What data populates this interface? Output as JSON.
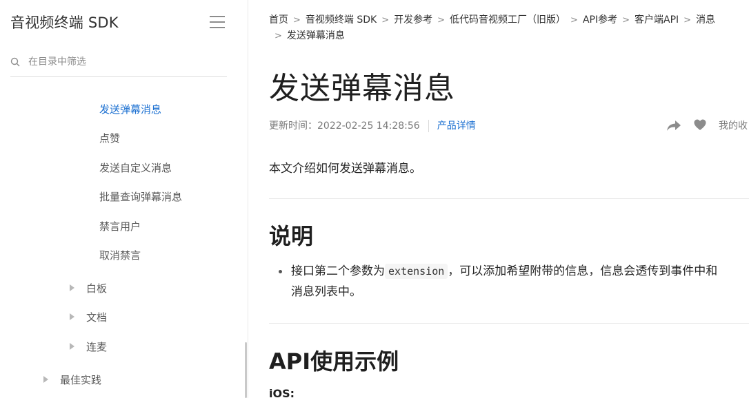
{
  "sidebar": {
    "title": "音视频终端 SDK",
    "filter_placeholder": "在目录中筛选",
    "items": [
      {
        "label": "发送弹幕消息",
        "active": true
      },
      {
        "label": "点赞"
      },
      {
        "label": "发送自定义消息"
      },
      {
        "label": "批量查询弹幕消息"
      },
      {
        "label": "禁言用户"
      },
      {
        "label": "取消禁言"
      },
      {
        "label": "白板",
        "collapsible": true
      },
      {
        "label": "文档",
        "collapsible": true
      },
      {
        "label": "连麦",
        "collapsible": true
      },
      {
        "label": "最佳实践",
        "collapsible": true
      }
    ]
  },
  "breadcrumb": {
    "items": [
      "首页",
      "音视频终端 SDK",
      "开发参考",
      "低代码音视频工厂（旧版）",
      "API参考",
      "客户端API",
      "消息",
      "发送弹幕消息"
    ],
    "separator": ">"
  },
  "article": {
    "title": "发送弹幕消息",
    "updated_label": "更新时间：",
    "updated_time": "2022-02-25 14:28:56",
    "product_link": "产品详情",
    "favorite_label": "我的收",
    "intro": "本文介绍如何发送弹幕消息。",
    "section1_title": "说明",
    "bullet_part1": "接口第二个参数为",
    "bullet_code": "extension",
    "bullet_part2": "，可以添加希望附带的信息，信息会透传到事件中和",
    "bullet_line2": "消息列表中。",
    "section2_title": "API使用示例",
    "platform_label": "iOS:"
  },
  "icons": {
    "search": "search-icon",
    "menu": "hamburger-menu-icon",
    "share": "share-icon",
    "heart": "heart-icon",
    "caret": "caret-right-icon"
  },
  "colors": {
    "accent": "#1a6fd1",
    "text": "#262626",
    "muted": "#7a7a7a"
  }
}
